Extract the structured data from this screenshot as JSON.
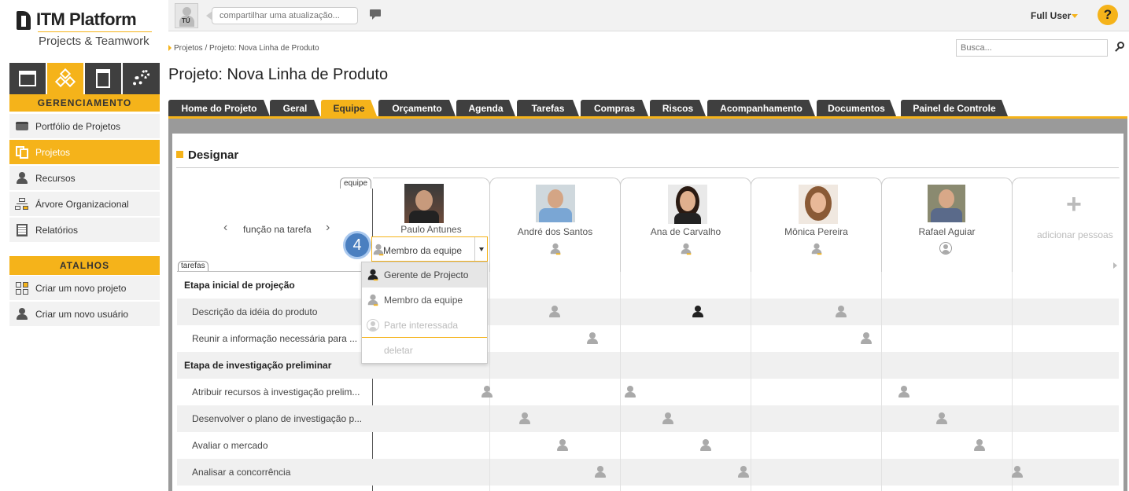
{
  "brand": {
    "name": "ITM Platform",
    "tagline": "Projects & Teamwork"
  },
  "top": {
    "avatar_text": "TÚ",
    "update_placeholder": "compartilhar uma atualização...",
    "user_name": "Full User",
    "help_label": "?"
  },
  "breadcrumb": "Projetos / Projeto: Nova Linha de Produto",
  "search": {
    "placeholder": "Busca..."
  },
  "page_title": "Projeto: Nova Linha de Produto",
  "sidebar": {
    "section1": "GERENCIAMENTO",
    "items": [
      {
        "label": "Portfólio de Projetos",
        "icon": "briefcase-icon"
      },
      {
        "label": "Projetos",
        "icon": "projects-icon"
      },
      {
        "label": "Recursos",
        "icon": "person-icon"
      },
      {
        "label": "Árvore Organizacional",
        "icon": "org-tree-icon"
      },
      {
        "label": "Relatórios",
        "icon": "report-icon"
      }
    ],
    "section2": "ATALHOS",
    "shortcuts": [
      {
        "label": "Criar um novo projeto",
        "icon": "new-project-icon"
      },
      {
        "label": "Criar um novo usuário",
        "icon": "new-user-icon"
      }
    ]
  },
  "tabs": [
    "Home do Projeto",
    "Geral",
    "Equipe",
    "Orçamento",
    "Agenda",
    "Tarefas",
    "Compras",
    "Riscos",
    "Acompanhamento",
    "Documentos",
    "Painel de Controle"
  ],
  "active_tab": "Equipe",
  "section_title": "Designar",
  "equipe_tag": "equipe",
  "tarefas_tag": "tarefas",
  "role_nav": {
    "label": "função na tarefa",
    "prev": "‹",
    "next": "›"
  },
  "people": [
    {
      "name": "Paulo Antunes",
      "role": "Membro da equipe"
    },
    {
      "name": "André dos Santos"
    },
    {
      "name": "Ana de Carvalho"
    },
    {
      "name": "Mônica Pereira"
    },
    {
      "name": "Rafael Aguiar"
    }
  ],
  "add_people": {
    "icon": "+",
    "label": "adicionar pessoas"
  },
  "step_badge": "4",
  "dropdown": {
    "options": [
      "Gerente de Projecto",
      "Membro da equipe",
      "Parte interessada",
      "deletar"
    ],
    "selected": "Membro da equipe"
  },
  "groups": [
    "Etapa inicial de projeção",
    "Etapa de investigação preliminar"
  ],
  "tasks": [
    "Descrição da idéia do produto",
    "Reunir a informação necessária para ...",
    "Atribuir recursos à investigação prelim...",
    "Desenvolver o plano de investigação p...",
    "Avaliar o mercado",
    "Analisar a concorrência"
  ],
  "colors": {
    "accent": "#f5b31a",
    "dark": "#3f3f3f"
  }
}
